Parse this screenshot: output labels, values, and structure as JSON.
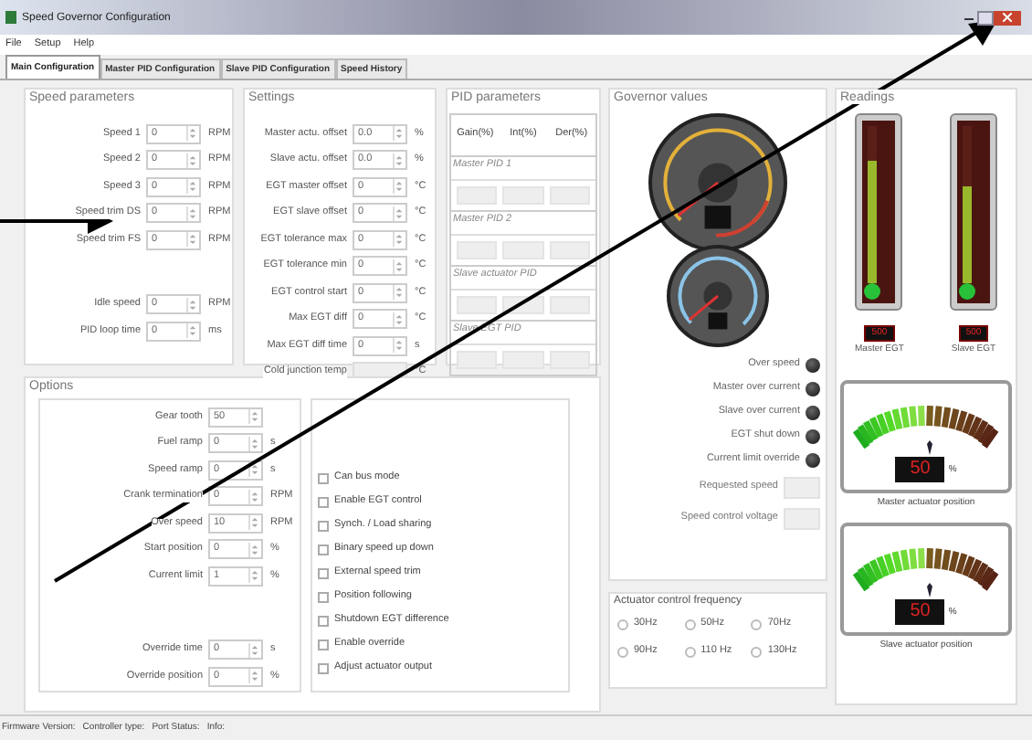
{
  "window": {
    "title": "Speed Governor Configuration"
  },
  "menu": [
    "File",
    "Setup",
    "Help"
  ],
  "tabs": [
    {
      "label": "Main Configuration",
      "selected": true
    },
    {
      "label": "Master PID Configuration",
      "selected": false
    },
    {
      "label": "Slave PID Configuration",
      "selected": false
    },
    {
      "label": "Speed History",
      "selected": false
    }
  ],
  "speed_parameters": {
    "title": "Speed parameters",
    "groups": [
      [
        {
          "label": "Speed 1",
          "value": "0",
          "unit": "RPM"
        },
        {
          "label": "Speed 2",
          "value": "0",
          "unit": "RPM"
        },
        {
          "label": "Speed 3",
          "value": "0",
          "unit": "RPM"
        },
        {
          "label": "Speed trim DS",
          "value": "0",
          "unit": "RPM"
        },
        {
          "label": "Speed trim FS",
          "value": "0",
          "unit": "RPM"
        }
      ],
      [
        {
          "label": "Idle speed",
          "value": "0",
          "unit": "RPM"
        },
        {
          "label": "PID loop time",
          "value": "0",
          "unit": "ms"
        }
      ]
    ]
  },
  "settings": {
    "title": "Settings",
    "fields": [
      {
        "kind": "spin",
        "label": "Master actu. offset",
        "value": "0.0",
        "unit": "%"
      },
      {
        "kind": "spin",
        "label": "Slave actu. offset",
        "value": "0.0",
        "unit": "%"
      },
      {
        "kind": "spin",
        "label": "EGT master offset",
        "value": "0",
        "unit": "°C"
      },
      {
        "kind": "spin",
        "label": "EGT slave offset",
        "value": "0",
        "unit": "°C"
      },
      {
        "kind": "spin",
        "label": "EGT tolerance max",
        "value": "0",
        "unit": "°C"
      },
      {
        "kind": "spin",
        "label": "EGT tolerance min",
        "value": "0",
        "unit": "°C"
      },
      {
        "kind": "spin",
        "label": "EGT control start",
        "value": "0",
        "unit": "°C"
      },
      {
        "kind": "spin",
        "label": "Max EGT diff",
        "value": "0",
        "unit": "°C"
      },
      {
        "kind": "spin",
        "label": "Max EGT diff time",
        "value": "0",
        "unit": "s"
      },
      {
        "kind": "readout",
        "label": "Cold junction temp",
        "unit": "°C"
      }
    ]
  },
  "pid_parameters": {
    "title": "PID parameters",
    "columns": [
      "Gain(%)",
      "Int(%)",
      "Der(%)"
    ],
    "groups": [
      "Master PID 1",
      "Master PID 2",
      "Slave actuator PID",
      "Slave EGT PID"
    ]
  },
  "governor_values": {
    "title": "Governor values",
    "indicators": [
      "Over speed",
      "Master over current",
      "Slave over current",
      "EGT shut down",
      "Current limit override"
    ],
    "readouts": [
      "Requested speed",
      "Speed control voltage"
    ]
  },
  "actuator_frequency": {
    "title": "Actuator control frequency",
    "options": [
      {
        "label": "30Hz",
        "selected": false
      },
      {
        "label": "50Hz",
        "selected": false
      },
      {
        "label": "70Hz",
        "selected": false
      },
      {
        "label": "90Hz",
        "selected": false
      },
      {
        "label": "110 Hz",
        "selected": false
      },
      {
        "label": "130Hz",
        "selected": false
      }
    ]
  },
  "readings": {
    "title": "Readings",
    "thermometers": [
      {
        "label": "Master EGT",
        "reading": "500",
        "level": 0.78
      },
      {
        "label": "Slave EGT",
        "reading": "500",
        "level": 0.62
      }
    ],
    "actuators": [
      {
        "label": "Master actuator position",
        "reading": "50",
        "unit": "%",
        "level": 0.5
      },
      {
        "label": "Slave actuator position",
        "reading": "50",
        "unit": "%",
        "level": 0.5
      }
    ]
  },
  "options": {
    "title": "Options",
    "groups": [
      [
        {
          "label": "Gear tooth",
          "value": "50"
        },
        {
          "label": "Fuel ramp",
          "value": "0",
          "unit": "s"
        },
        {
          "label": "Speed ramp",
          "value": "0",
          "unit": "s"
        },
        {
          "label": "Crank termination",
          "value": "0",
          "unit": "RPM"
        },
        {
          "label": "Over speed",
          "value": "10",
          "unit": "RPM"
        },
        {
          "label": "Start position",
          "value": "0",
          "unit": "%"
        },
        {
          "label": "Current limit",
          "value": "1",
          "unit": "%"
        }
      ],
      [
        {
          "label": "Override time",
          "value": "0",
          "unit": "s"
        },
        {
          "label": "Override position",
          "value": "0",
          "unit": "%"
        }
      ]
    ],
    "checkboxes": [
      {
        "label": "Can bus mode",
        "checked": false
      },
      {
        "label": "Enable EGT control",
        "checked": false
      },
      {
        "label": "Synch.  / Load sharing",
        "checked": false
      },
      {
        "label": "Binary speed up down",
        "checked": false
      },
      {
        "label": "External speed trim",
        "checked": false
      },
      {
        "label": "Position following",
        "checked": false
      },
      {
        "label": "Shutdown EGT difference",
        "checked": false
      },
      {
        "label": "Enable override",
        "checked": false
      },
      {
        "label": "Adjust actuator output",
        "checked": false
      }
    ]
  },
  "status_bar": [
    "Firmware Version:",
    "Controller type:",
    "Port Status:",
    "Info:"
  ]
}
